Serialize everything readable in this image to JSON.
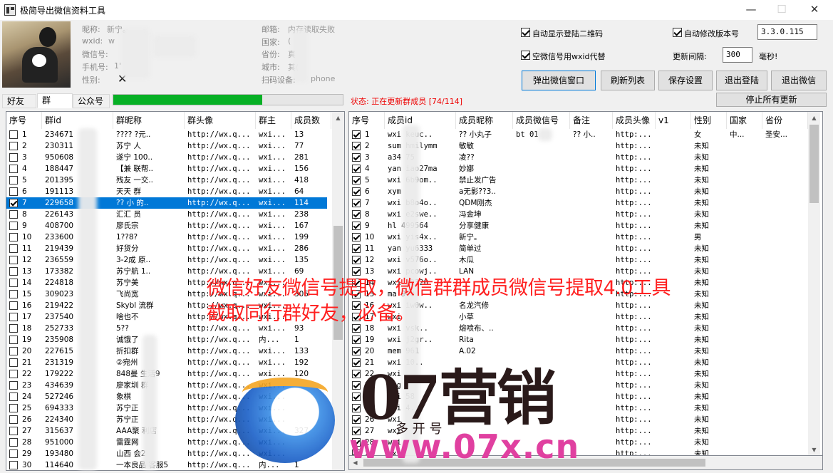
{
  "window": {
    "title": "极简导出微信资料工具",
    "minimize": "—",
    "maximize": "☐",
    "close": "✕"
  },
  "profile": {
    "nickname_label": "昵称:",
    "nickname": "新宁。",
    "wxid_label": "wxid:",
    "wxid": "w",
    "wxno_label": "微信号:",
    "wxno": "",
    "phone_label": "手机号:",
    "phone": "1'",
    "gender_label": "性别:",
    "gender": "✕",
    "email_label": "邮箱:",
    "email": "内存读取失败",
    "country_label": "国家:",
    "country": "(",
    "province_label": "省份:",
    "province": "真",
    "city_label": "城市:",
    "city": "其(",
    "device_label": "扫码设备:",
    "device": "phone"
  },
  "options": {
    "show_qr": "自动显示登陆二维码",
    "empty_wxid": "空微信号用wxid代替",
    "auto_version": "自动修改版本号",
    "version": "3.3.0.115",
    "interval_label": "更新间隔:",
    "interval": "300",
    "interval_unit": "毫秒!"
  },
  "buttons": {
    "popup": "弹出微信窗口",
    "refresh": "刷新列表",
    "save": "保存设置",
    "logout": "退出登陆",
    "quit": "退出微信",
    "stop": "停止所有更新"
  },
  "tabs": [
    "好友",
    "群",
    "公众号"
  ],
  "progress": {
    "fraction": 0.65
  },
  "status": "状态: 正在更新群成员 [74/114]",
  "groups": {
    "headers": [
      "序号",
      "群id",
      "群昵称",
      "群头像",
      "群主",
      "成员数"
    ],
    "rows": [
      {
        "n": "1",
        "id": "234671",
        "name": "????  ?元..",
        "avatar": "http://wx.q...",
        "owner": "wxi...",
        "count": "13",
        "checked": false
      },
      {
        "n": "2",
        "id": "230311",
        "name": "苏宁  人",
        "avatar": "http://wx.q...",
        "owner": "wxi...",
        "count": "77",
        "checked": false
      },
      {
        "n": "3",
        "id": "950608",
        "name": "遂宁  100..",
        "avatar": "http://wx.q...",
        "owner": "wxi...",
        "count": "281",
        "checked": false
      },
      {
        "n": "4",
        "id": "188447",
        "name": "【兼  联帮..",
        "avatar": "http://wx.q...",
        "owner": "wxi...",
        "count": "156",
        "checked": false
      },
      {
        "n": "5",
        "id": "201395",
        "name": "残友  一交..",
        "avatar": "http://wx.q...",
        "owner": "wxi...",
        "count": "418",
        "checked": false
      },
      {
        "n": "6",
        "id": "191113",
        "name": "天天  群",
        "avatar": "http://wx.q...",
        "owner": "wxi...",
        "count": "64",
        "checked": false
      },
      {
        "n": "7",
        "id": "229658",
        "name": "?? 小  的..",
        "avatar": "http://wx.q...",
        "owner": "wxi...",
        "count": "114",
        "checked": true
      },
      {
        "n": "8",
        "id": "226143",
        "name": "汇汇  员",
        "avatar": "http://wx.q...",
        "owner": "wxi...",
        "count": "238",
        "checked": false
      },
      {
        "n": "9",
        "id": "408700",
        "name": "廖氏宗",
        "avatar": "http://wx.q...",
        "owner": "wxi...",
        "count": "167",
        "checked": false
      },
      {
        "n": "10",
        "id": "233600",
        "name": "1??8?",
        "avatar": "http://wx.q...",
        "owner": "wxi...",
        "count": "199",
        "checked": false
      },
      {
        "n": "11",
        "id": "219439",
        "name": "好货分",
        "avatar": "http://wx.q...",
        "owner": "wxi...",
        "count": "286",
        "checked": false
      },
      {
        "n": "12",
        "id": "236559",
        "name": "3-2成  原..",
        "avatar": "http://wx.q...",
        "owner": "wxi...",
        "count": "135",
        "checked": false
      },
      {
        "n": "13",
        "id": "173382",
        "name": "苏宁航  1..",
        "avatar": "http://wx.q...",
        "owner": "wxi...",
        "count": "69",
        "checked": false
      },
      {
        "n": "14",
        "id": "224818",
        "name": "苏宁美",
        "avatar": "http://wx.q...",
        "owner": "wxi...",
        "count": "",
        "checked": false
      },
      {
        "n": "15",
        "id": "309023",
        "name": "飞尚宽",
        "avatar": "http://wx.q...",
        "owner": "wxi...",
        "count": "305",
        "checked": false
      },
      {
        "n": "16",
        "id": "219422",
        "name": "Skybl  流群",
        "avatar": "http://wx.q...",
        "owner": "wxi...",
        "count": "",
        "checked": false
      },
      {
        "n": "17",
        "id": "237540",
        "name": "啥也不",
        "avatar": "http://wx.q...",
        "owner": "wxi...",
        "count": "",
        "checked": false
      },
      {
        "n": "18",
        "id": "252733",
        "name": "5??",
        "avatar": "http://wx.q...",
        "owner": "wxi...",
        "count": "93",
        "checked": false
      },
      {
        "n": "19",
        "id": "235908",
        "name": "诚饿了",
        "avatar": "http://wx.q...",
        "owner": "内...",
        "count": "1",
        "checked": false
      },
      {
        "n": "20",
        "id": "227615",
        "name": "折扣群",
        "avatar": "http://wx.q...",
        "owner": "wxi...",
        "count": "133",
        "checked": false
      },
      {
        "n": "21",
        "id": "231319",
        "name": "②宛州",
        "avatar": "http://wx.q...",
        "owner": "wxi...",
        "count": "192",
        "checked": false
      },
      {
        "n": "22",
        "id": "179222",
        "name": "848曼  生活9",
        "avatar": "http://wx.q...",
        "owner": "wxi...",
        "count": "120",
        "checked": false
      },
      {
        "n": "23",
        "id": "434639",
        "name": "廖家圳  群",
        "avatar": "http://wx.q...",
        "owner": "wxi...",
        "count": "",
        "checked": false
      },
      {
        "n": "24",
        "id": "527246",
        "name": "象棋",
        "avatar": "http://wx.q...",
        "owner": "wxi...",
        "count": "",
        "checked": false
      },
      {
        "n": "25",
        "id": "694333",
        "name": "苏宁正",
        "avatar": "http://wx.q...",
        "owner": "wxi...",
        "count": "",
        "checked": false
      },
      {
        "n": "26",
        "id": "224340",
        "name": "苏宁正",
        "avatar": "http://wx.q...",
        "owner": "wxi...",
        "count": "",
        "checked": false
      },
      {
        "n": "27",
        "id": "315637",
        "name": "AAA聚  利店",
        "avatar": "http://wx.q...",
        "owner": "wxi...",
        "count": "327",
        "checked": false
      },
      {
        "n": "28",
        "id": "951000",
        "name": "雷霆网",
        "avatar": "http://wx.q...",
        "owner": "wxi...",
        "count": "",
        "checked": false
      },
      {
        "n": "29",
        "id": "193480",
        "name": "山西  会2",
        "avatar": "http://wx.q...",
        "owner": "wxi...",
        "count": "",
        "checked": false
      },
      {
        "n": "30",
        "id": "114640",
        "name": "一本良品 客服5",
        "avatar": "http://wx.q...",
        "owner": "内...",
        "count": "1",
        "checked": false
      }
    ]
  },
  "members": {
    "headers": [
      "序号",
      "成员id",
      "成员昵称",
      "成员微信号",
      "备注",
      "成员头像",
      "v1",
      "性别",
      "国家",
      "省份"
    ],
    "rows": [
      {
        "n": "1",
        "id": "wxi  keuc..",
        "nick": "?? 小丸子",
        "wx": "bt   01",
        "remark": "?? 小..",
        "avatar": "http:...",
        "gender": "女",
        "country": "中...",
        "province": "圣安..."
      },
      {
        "n": "2",
        "id": "sum  hmilymm",
        "nick": "敏敏",
        "wx": "",
        "remark": "",
        "avatar": "http:...",
        "gender": "未知",
        "country": "",
        "province": ""
      },
      {
        "n": "3",
        "id": "a34  75",
        "nick": "凌??",
        "wx": "",
        "remark": "",
        "avatar": "http:...",
        "gender": "未知",
        "country": "",
        "province": ""
      },
      {
        "n": "4",
        "id": "yan  iao27ma",
        "nick": "妙娜",
        "wx": "",
        "remark": "",
        "avatar": "http:...",
        "gender": "未知",
        "country": "",
        "province": ""
      },
      {
        "n": "5",
        "id": "wxi  6b9om..",
        "nick": "禁止发广告",
        "wx": "",
        "remark": "",
        "avatar": "http:...",
        "gender": "未知",
        "country": "",
        "province": ""
      },
      {
        "n": "6",
        "id": "xym",
        "nick": "a无影??3..",
        "wx": "",
        "remark": "",
        "avatar": "http:...",
        "gender": "未知",
        "country": "",
        "province": ""
      },
      {
        "n": "7",
        "id": "wxi  b8o4o..",
        "nick": "QDM刚杰",
        "wx": "",
        "remark": "",
        "avatar": "http:...",
        "gender": "未知",
        "country": "",
        "province": ""
      },
      {
        "n": "8",
        "id": "wxi  e2swe..",
        "nick": "冯金坤",
        "wx": "",
        "remark": "",
        "avatar": "http:...",
        "gender": "未知",
        "country": "",
        "province": ""
      },
      {
        "n": "9",
        "id": "hl  499564",
        "nick": "分享健康",
        "wx": "",
        "remark": "",
        "avatar": "http:...",
        "gender": "未知",
        "country": "",
        "province": ""
      },
      {
        "n": "10",
        "id": "wxi  yis4x..",
        "nick": "新宁。",
        "wx": "",
        "remark": "",
        "avatar": "http:...",
        "gender": "男",
        "country": "",
        "province": ""
      },
      {
        "n": "11",
        "id": "yan  yu6333",
        "nick": "简单过",
        "wx": "",
        "remark": "",
        "avatar": "http:...",
        "gender": "未知",
        "country": "",
        "province": ""
      },
      {
        "n": "12",
        "id": "wxi  v576o..",
        "nick": "木瓜",
        "wx": "",
        "remark": "",
        "avatar": "http:...",
        "gender": "未知",
        "country": "",
        "province": ""
      },
      {
        "n": "13",
        "id": "wxi  pcowj..",
        "nick": "LAN",
        "wx": "",
        "remark": "",
        "avatar": "http:...",
        "gender": "未知",
        "country": "",
        "province": ""
      },
      {
        "n": "14",
        "id": "wxi  12320",
        "nick": "",
        "wx": "",
        "remark": "",
        "avatar": "http:...",
        "gender": "未知",
        "country": "",
        "province": ""
      },
      {
        "n": "15",
        "id": "ma  940",
        "nick": "",
        "wx": "",
        "remark": "",
        "avatar": "http:...",
        "gender": "未知",
        "country": "",
        "province": ""
      },
      {
        "n": "16",
        "id": "wxi  iw0w..",
        "nick": "名龙汽修",
        "wx": "",
        "remark": "",
        "avatar": "http:...",
        "gender": "未知",
        "country": "",
        "province": ""
      },
      {
        "n": "17",
        "id": "wxi",
        "nick": "小草",
        "wx": "",
        "remark": "",
        "avatar": "http:...",
        "gender": "未知",
        "country": "",
        "province": ""
      },
      {
        "n": "18",
        "id": "wxi  vsk..",
        "nick": "熔喷布、..",
        "wx": "",
        "remark": "",
        "avatar": "http:...",
        "gender": "未知",
        "country": "",
        "province": ""
      },
      {
        "n": "19",
        "id": "wxi  j2gr..",
        "nick": "Rita",
        "wx": "",
        "remark": "",
        "avatar": "http:...",
        "gender": "未知",
        "country": "",
        "province": ""
      },
      {
        "n": "20",
        "id": "mem  961",
        "nick": "A.02",
        "wx": "",
        "remark": "",
        "avatar": "http:...",
        "gender": "未知",
        "country": "",
        "province": ""
      },
      {
        "n": "21",
        "id": "wxi  10..",
        "nick": "",
        "wx": "",
        "remark": "",
        "avatar": "http:...",
        "gender": "未知",
        "country": "",
        "province": ""
      },
      {
        "n": "22",
        "id": "wxi",
        "nick": "",
        "wx": "",
        "remark": "",
        "avatar": "http:...",
        "gender": "未知",
        "country": "",
        "province": ""
      },
      {
        "n": "23",
        "id": "ang",
        "nick": "",
        "wx": "",
        "remark": "",
        "avatar": "http:...",
        "gender": "未知",
        "country": "",
        "province": ""
      },
      {
        "n": "24",
        "id": "wxi  58",
        "nick": "",
        "wx": "",
        "remark": "",
        "avatar": "http:...",
        "gender": "未知",
        "country": "",
        "province": ""
      },
      {
        "n": "25",
        "id": "wxi  4..",
        "nick": "",
        "wx": "",
        "remark": "",
        "avatar": "http:...",
        "gender": "未知",
        "country": "",
        "province": ""
      },
      {
        "n": "26",
        "id": "wxi",
        "nick": "",
        "wx": "",
        "remark": "",
        "avatar": "http:...",
        "gender": "未知",
        "country": "",
        "province": ""
      },
      {
        "n": "27",
        "id": "wxi",
        "nick": "",
        "wx": "",
        "remark": "",
        "avatar": "http:...",
        "gender": "未知",
        "country": "",
        "province": ""
      },
      {
        "n": "28",
        "id": "wxi",
        "nick": "",
        "wx": "",
        "remark": "",
        "avatar": "http:...",
        "gender": "未知",
        "country": "",
        "province": ""
      },
      {
        "n": "29",
        "id": "wxi",
        "nick": "",
        "wx": "",
        "remark": "",
        "avatar": "http:...",
        "gender": "未知",
        "country": "",
        "province": ""
      }
    ]
  },
  "overlay": {
    "line1": "微信好友微信号提取，微信群群成员微信号提取4.0工具",
    "line2": "截取同行群好友，必备。"
  },
  "watermark": {
    "brand": "07营销",
    "sub": "多  开  号",
    "url": "www.07x.cn"
  }
}
